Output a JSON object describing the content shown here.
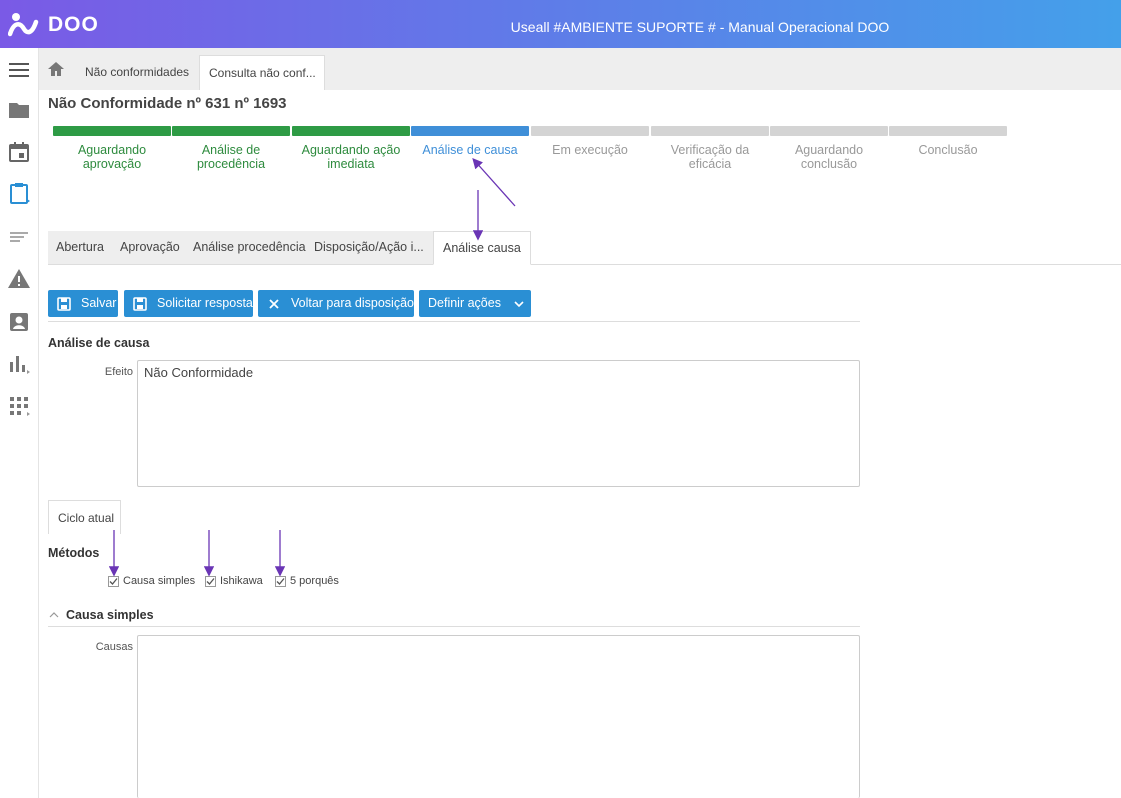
{
  "header": {
    "logo_text": "DOO",
    "app_title": "Useall #AMBIENTE SUPORTE # - Manual Operacional DOO"
  },
  "sidebar": {
    "icons": [
      "menu-icon",
      "folder-icon",
      "calendar-icon",
      "clipboard-icon",
      "lines-icon",
      "warning-icon",
      "contact-card-icon",
      "bar-chart-icon",
      "grid-apps-icon"
    ]
  },
  "breadcrumb": {
    "items": [
      {
        "label": "Não conformidades"
      },
      {
        "label": "Consulta não conf..."
      }
    ]
  },
  "page": {
    "title": "Não Conformidade nº 631 nº 1693"
  },
  "workflow": {
    "steps": [
      {
        "label": "Aguardando aprovação",
        "state": "done"
      },
      {
        "label": "Análise de procedência",
        "state": "done"
      },
      {
        "label": "Aguardando ação imediata",
        "state": "done"
      },
      {
        "label": "Análise de causa",
        "state": "current"
      },
      {
        "label": "Em execução",
        "state": "todo"
      },
      {
        "label": "Verificação da eficácia",
        "state": "todo"
      },
      {
        "label": "Aguardando conclusão",
        "state": "todo"
      },
      {
        "label": "Conclusão",
        "state": "todo"
      }
    ],
    "colors": {
      "done": "#2e9b45",
      "current": "#3f8fd8",
      "todo": "#d4d4d4"
    }
  },
  "tabs": [
    {
      "label": "Abertura"
    },
    {
      "label": "Aprovação"
    },
    {
      "label": "Análise procedência"
    },
    {
      "label": "Disposição/Ação i..."
    },
    {
      "label": "Análise causa"
    }
  ],
  "toolbar": {
    "save_label": "Salvar",
    "request_label": "Solicitar resposta",
    "back_label": "Voltar para disposição",
    "define_label": "Definir ações"
  },
  "analysis": {
    "section_title": "Análise de causa",
    "effect_label": "Efeito",
    "effect_value": "Não Conformidade",
    "cycle_tab": "Ciclo atual",
    "methods_title": "Métodos",
    "methods": [
      {
        "label": "Causa simples",
        "checked": true
      },
      {
        "label": "Ishikawa",
        "checked": true
      },
      {
        "label": "5 porquês",
        "checked": true
      }
    ],
    "simple_cause_title": "Causa simples",
    "causes_label": "Causas",
    "causes_value": ""
  },
  "colors": {
    "accent": "#2a8fd4",
    "annotation_arrow": "#6a35b5"
  }
}
